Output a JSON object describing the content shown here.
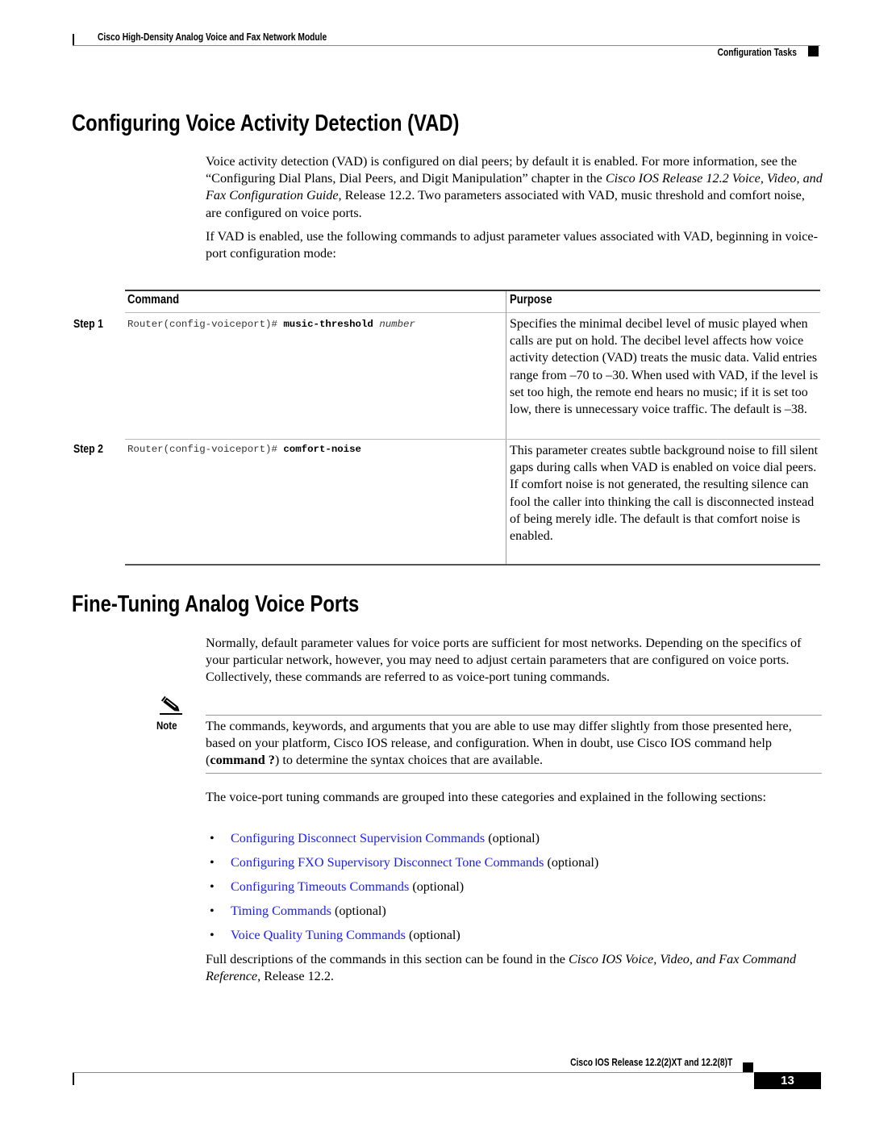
{
  "header": {
    "doc_title": "Cisco High-Density Analog Voice and Fax Network Module",
    "section": "Configuration Tasks"
  },
  "vad_section": {
    "heading": "Configuring Voice Activity Detection (VAD)",
    "para1": {
      "before_italic": "Voice activity detection (VAD) is configured on dial peers; by default it is enabled. For more information, see the “Configuring Dial Plans, Dial Peers, and Digit Manipulation” chapter in the ",
      "italic": "Cisco IOS Release  12.2 Voice, Video, and Fax Configuration Guide,",
      "after_italic": " Release 12.2. Two parameters associated with VAD, music threshold and comfort noise, are configured on voice ports."
    },
    "para2": "If VAD is enabled, use the following commands to adjust parameter values associated with VAD, beginning in voice-port configuration mode:",
    "table": {
      "headers": [
        "Command",
        "Purpose"
      ],
      "rows": [
        {
          "step": "Step 1",
          "prompt": "Router(config-voiceport)# ",
          "keyword": "music-threshold",
          "argument": "number",
          "purpose": "Specifies the minimal decibel level of music played when calls are put on hold. The decibel level affects how voice activity detection (VAD) treats the music data. Valid entries range from –70 to –30. When used with VAD, if the level is set too high, the remote end hears no music; if it is set too low, there is unnecessary voice traffic. The default is –38."
        },
        {
          "step": "Step 2",
          "prompt": "Router(config-voiceport)# ",
          "keyword": "comfort-noise",
          "argument": "",
          "purpose": "This parameter creates subtle background noise to fill silent gaps during calls when VAD is enabled on voice dial peers. If comfort noise is not generated, the resulting silence can fool the caller into thinking the call is disconnected instead of being merely idle. The default is that comfort noise is enabled."
        }
      ]
    }
  },
  "fine_tuning_section": {
    "heading": "Fine-Tuning Analog Voice Ports",
    "para1": "Normally, default parameter values for voice ports are sufficient for most networks. Depending on the specifics of your particular network, however, you may need to adjust certain parameters that are configured on voice ports. Collectively, these commands are referred to as voice-port tuning commands.",
    "note": {
      "label": "Note",
      "icon": "pencil-icon",
      "text_before": "The commands, keywords, and arguments that you are able to use may differ slightly from those presented here, based on your platform, Cisco IOS release, and configuration. When in doubt, use Cisco IOS command help (",
      "bold": "command ?",
      "text_after": ") to determine the syntax choices that are available."
    },
    "categories_intro": "The voice-port tuning commands are grouped into these categories and explained in the following sections:",
    "bullet": "•",
    "categories": [
      {
        "link": "Configuring Disconnect Supervision Commands",
        "suffix": " (optional)"
      },
      {
        "link": "Configuring FXO Supervisory Disconnect Tone Commands",
        "suffix": " (optional)"
      },
      {
        "link": "Configuring Timeouts Commands",
        "suffix": " (optional)"
      },
      {
        "link": "Timing Commands",
        "suffix": " (optional)"
      },
      {
        "link": "Voice Quality Tuning Commands",
        "suffix": " (optional)"
      }
    ],
    "full_desc": {
      "before_italic": "Full descriptions of the commands in this section can be found in the ",
      "italic": "Cisco IOS Voice, Video, and Fax Command Reference",
      "after_italic": ", Release 12.2."
    }
  },
  "footer": {
    "release": "Cisco IOS Release 12.2(2)XT and 12.2(8)T",
    "page_number": "13"
  },
  "colors": {
    "link": "#1a1aff",
    "text": "#000000"
  }
}
